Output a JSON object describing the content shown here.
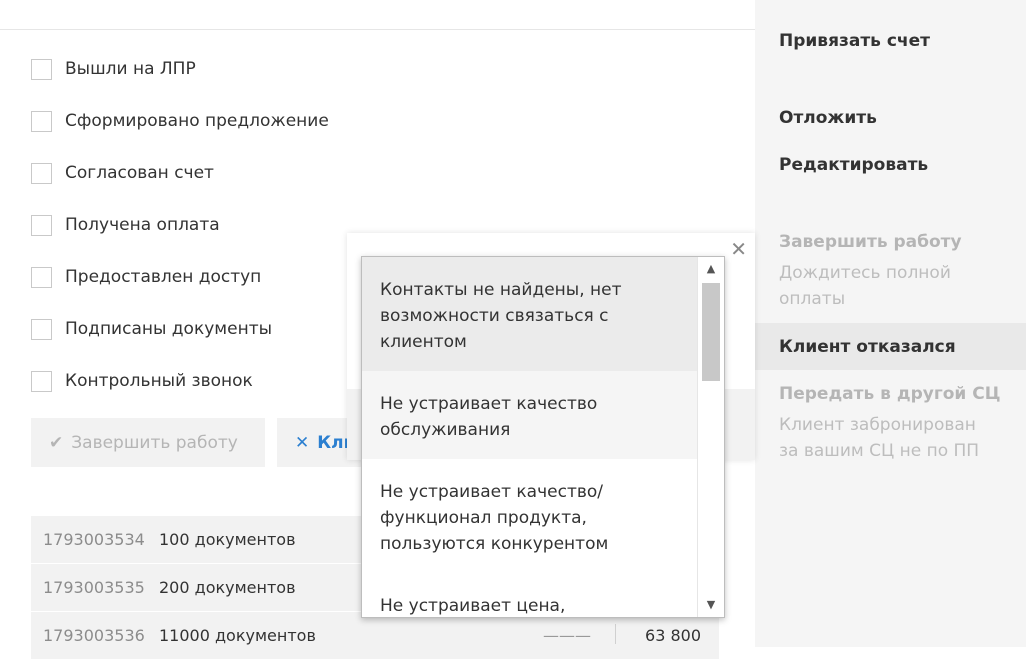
{
  "checklist": [
    {
      "label": "Вышли на ЛПР",
      "checked": false
    },
    {
      "label": "Сформировано предложение",
      "checked": false
    },
    {
      "label": "Согласован счет",
      "checked": false
    },
    {
      "label": "Получена оплата",
      "checked": false
    },
    {
      "label": "Предоставлен доступ",
      "checked": false
    },
    {
      "label": "Подписаны документы",
      "checked": false
    },
    {
      "label": "Контрольный звонок",
      "checked": false
    }
  ],
  "actions": {
    "finish_label": "Завершить работу",
    "finish_icon": "check-icon",
    "client_label": "Кли",
    "client_icon": "x-icon"
  },
  "table": {
    "rows": [
      {
        "id": "1793003534",
        "name": "100 документов",
        "dash": "",
        "price": ""
      },
      {
        "id": "1793003535",
        "name": "200 документов",
        "dash": "",
        "price": ""
      },
      {
        "id": "1793003536",
        "name": "11000 документов",
        "dash": "———",
        "price": "63 800"
      }
    ]
  },
  "sidebar": {
    "bind_invoice": "Привязать счет",
    "postpone": "Отложить",
    "edit": "Редактировать",
    "finish_work": "Завершить работу",
    "finish_work_hint": "Дождитесь полной оплаты",
    "client_refused": "Клиент отказался",
    "transfer": "Передать в другой СЦ",
    "transfer_hint": "Клиент забронирован за вашим СЦ не по ПП"
  },
  "modal": {
    "close_icon": "close-icon"
  },
  "dropdown": {
    "options": [
      "Контакты не найдены, нет возможности связаться с клиентом",
      "Не устраивает качество обслуживания",
      "Не устраивает качество/ функционал продукта, пользуются конкурентом",
      "Не устраивает цена,"
    ],
    "scroll_up_icon": "arrow-up-icon",
    "scroll_down_icon": "arrow-down-icon"
  }
}
